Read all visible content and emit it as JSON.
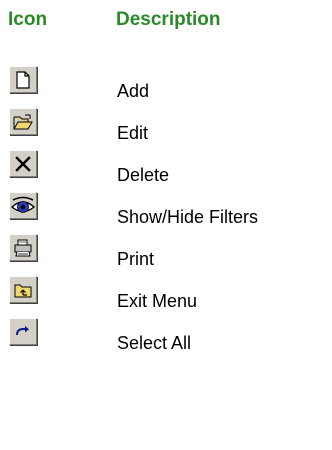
{
  "header": {
    "icon_label": "Icon",
    "description_label": "Description",
    "color": "#2a8a2a"
  },
  "rows": [
    {
      "icon": "new-document-icon",
      "label": "Add"
    },
    {
      "icon": "open-folder-icon",
      "label": "Edit"
    },
    {
      "icon": "delete-x-icon",
      "label": "Delete"
    },
    {
      "icon": "eye-icon",
      "label": "Show/Hide Filters"
    },
    {
      "icon": "printer-icon",
      "label": "Print"
    },
    {
      "icon": "exit-folder-icon",
      "label": "Exit Menu"
    },
    {
      "icon": "redo-arrow-icon",
      "label": "Select All"
    }
  ]
}
